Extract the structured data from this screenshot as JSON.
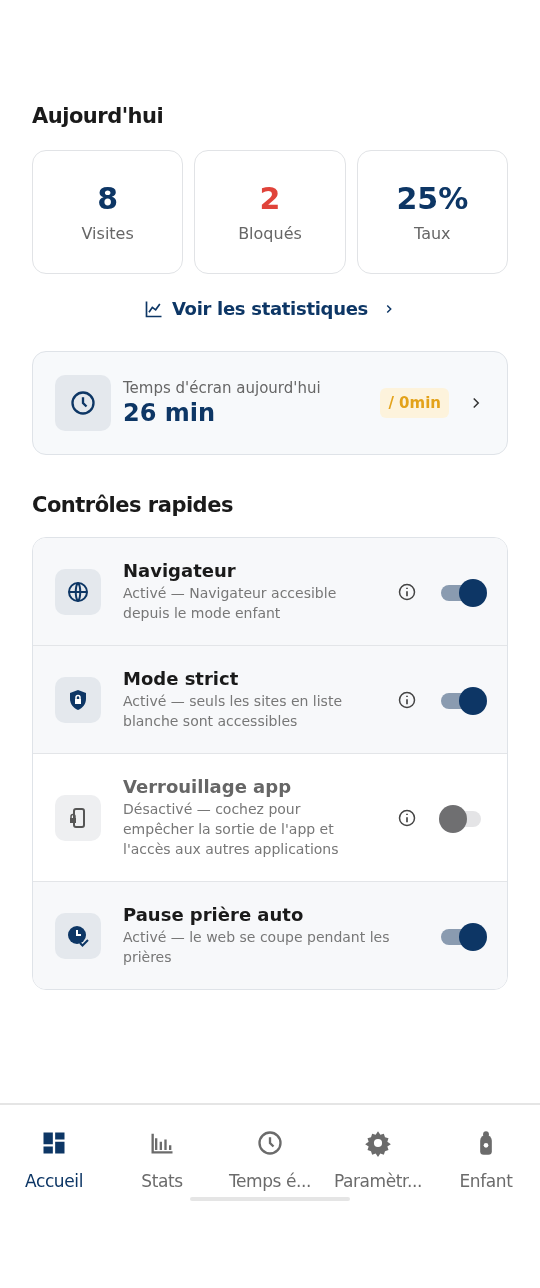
{
  "today": {
    "title": "Aujourd'hui",
    "stats": [
      {
        "value": "8",
        "label": "Visites",
        "color": "#0d3665"
      },
      {
        "value": "2",
        "label": "Bloqués",
        "color": "#e0433a"
      },
      {
        "value": "25%",
        "label": "Taux",
        "color": "#0d3665"
      }
    ]
  },
  "stats_link": {
    "label": "Voir les statistiques"
  },
  "screen_time": {
    "label": "Temps d'écran aujourd'hui",
    "value": "26 min",
    "limit": "/ 0min"
  },
  "quick_controls": {
    "title": "Contrôles rapides",
    "items": [
      {
        "kind": "globe",
        "title": "Navigateur",
        "description": "Activé — Navigateur accesible depuis le mode enfant",
        "on": true,
        "info": true
      },
      {
        "kind": "shield",
        "title": "Mode strict",
        "description": "Activé — seuls les sites en liste blanche sont accessibles",
        "on": true,
        "info": true
      },
      {
        "kind": "phone-lock",
        "title": "Verrouillage app",
        "description": "Désactivé — cochez pour empêcher la sortie de l'app et l'accès aux autres applications",
        "on": false,
        "info": true
      },
      {
        "kind": "clock-check",
        "title": "Pause prière auto",
        "description": "Activé — le web se coupe pendant les prières",
        "on": true,
        "info": false
      }
    ]
  },
  "nav": [
    {
      "kind": "dashboard",
      "label": "Accueil",
      "selected": true
    },
    {
      "kind": "bars",
      "label": "Stats",
      "selected": false
    },
    {
      "kind": "clock",
      "label": "Temps é...",
      "selected": false
    },
    {
      "kind": "gear",
      "label": "Paramètr...",
      "selected": false
    },
    {
      "kind": "child",
      "label": "Enfant",
      "selected": false
    }
  ]
}
